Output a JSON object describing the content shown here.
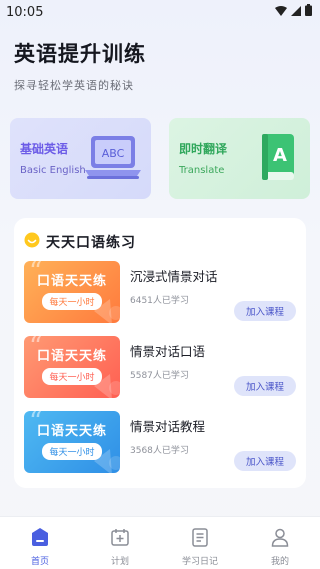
{
  "status_bar": {
    "time": "10:05",
    "icons": [
      "wifi-icon",
      "signal-icon",
      "battery-icon"
    ]
  },
  "header": {
    "title": "英语提升训练",
    "subtitle": "探寻轻松学英语的秘诀"
  },
  "features": [
    {
      "title": "基础英语",
      "subtitle": "Basic English",
      "icon": "abc-laptop-icon",
      "art_text": "ABC"
    },
    {
      "title": "即时翻译",
      "subtitle": "Translate",
      "icon": "translate-book-icon",
      "art_text": "A"
    }
  ],
  "practice": {
    "title": "天天口语练习",
    "icon": "smile-icon",
    "courses": [
      {
        "thumb_title": "口语天天练",
        "thumb_tag": "每天一小时",
        "name": "沉浸式情景对话",
        "count": "6451人已学习",
        "button": "加入课程",
        "theme": "#ff7a3d"
      },
      {
        "thumb_title": "口语天天练",
        "thumb_tag": "每天一小时",
        "name": "情景对话口语",
        "count": "5587人已学习",
        "button": "加入课程",
        "theme": "#ff5f52"
      },
      {
        "thumb_title": "口语天天练",
        "thumb_tag": "每天一小时",
        "name": "情景对话教程",
        "count": "3568人已学习",
        "button": "加入课程",
        "theme": "#2f8fe6"
      }
    ]
  },
  "tabbar": {
    "items": [
      {
        "label": "首页",
        "icon": "home-icon",
        "active": true
      },
      {
        "label": "计划",
        "icon": "calendar-icon",
        "active": false
      },
      {
        "label": "学习日记",
        "icon": "notebook-icon",
        "active": false
      },
      {
        "label": "我的",
        "icon": "user-icon",
        "active": false
      }
    ]
  },
  "colors": {
    "accent": "#4a5fe0",
    "join_button_bg": "#dfe4fa",
    "basic_card": "#d5dafa",
    "translate_card": "#cfefd9"
  }
}
